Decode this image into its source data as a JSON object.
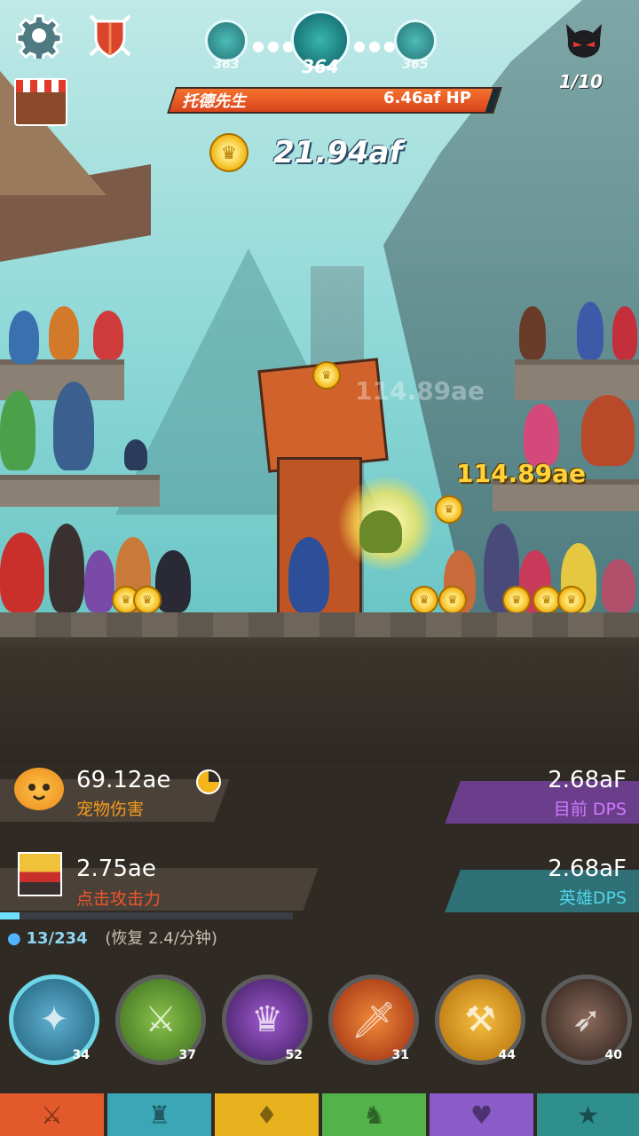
{
  "stages": {
    "prev": "363",
    "current": "364",
    "next": "365"
  },
  "boss": {
    "name": "托德先生",
    "hp": "6.46af HP"
  },
  "gold": "21.94af",
  "enemy_wave": "1/10",
  "damage_popups": [
    "114.89ae",
    "114.89ae"
  ],
  "stats": {
    "pet_damage_value": "69.12ae",
    "pet_damage_label": "宠物伤害",
    "tap_damage_value": "2.75ae",
    "tap_damage_label": "点击攻击力",
    "current_dps_value": "2.68aF",
    "current_dps_label": "目前 DPS",
    "hero_dps_value": "2.68aF",
    "hero_dps_label": "英雄DPS"
  },
  "mana": {
    "text": "13/234",
    "regen": "(恢复 2.4/分钟)"
  },
  "skills": [
    {
      "icon": "phoenix-icon",
      "level": "34",
      "color": "#2d7fa0"
    },
    {
      "icon": "sword-icon",
      "level": "37",
      "color": "#4f8a2e"
    },
    {
      "icon": "crown-coin-icon",
      "level": "52",
      "color": "#5a2e8a"
    },
    {
      "icon": "flaming-sword-icon",
      "level": "31",
      "color": "#b0401c"
    },
    {
      "icon": "weapons-icon",
      "level": "44",
      "color": "#c47a10"
    },
    {
      "icon": "running-shadow-icon",
      "level": "40",
      "color": "#4a3a34"
    }
  ],
  "tabs": [
    {
      "icon": "sword-tab-icon",
      "color": "#e2592c"
    },
    {
      "icon": "helmet-tab-icon",
      "color": "#3ba6b5"
    },
    {
      "icon": "armor-tab-icon",
      "color": "#e8b21e"
    },
    {
      "icon": "pet-tab-icon",
      "color": "#54b24a"
    },
    {
      "icon": "heart-tab-icon",
      "color": "#8b5bc9"
    },
    {
      "icon": "star-tab-icon",
      "color": "#2f8f8c"
    }
  ]
}
